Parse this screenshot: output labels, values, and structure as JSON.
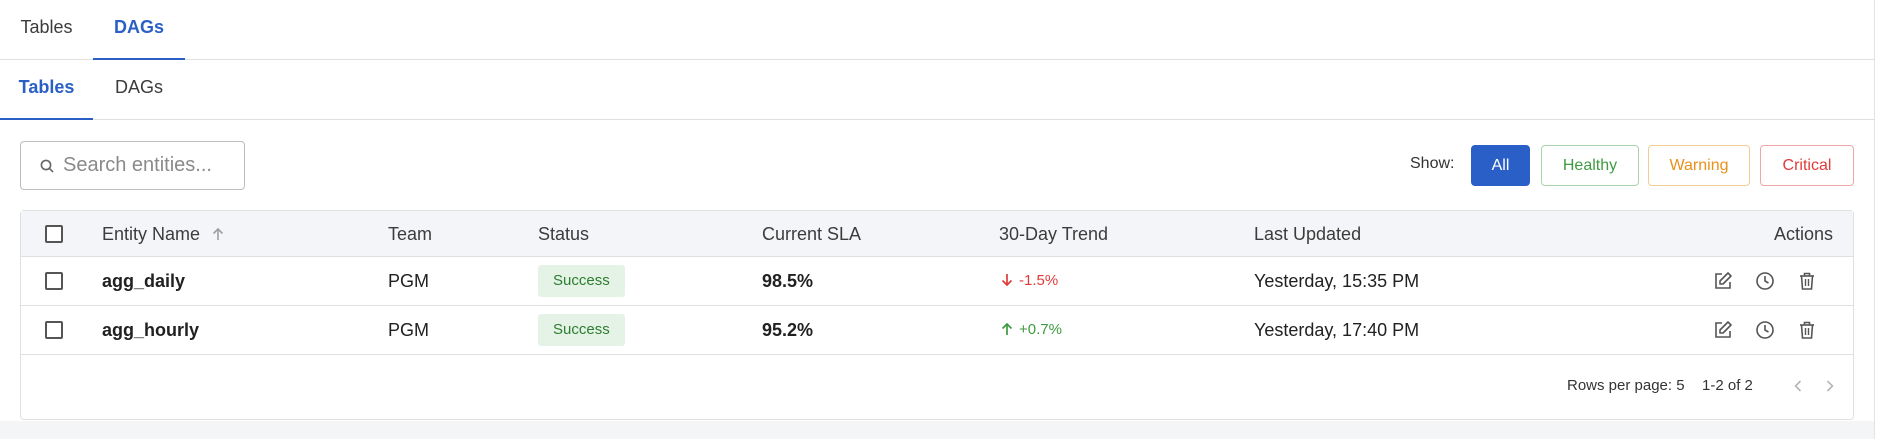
{
  "top_tabs": [
    {
      "label": "Tables",
      "active": false
    },
    {
      "label": "DAGs",
      "active": true
    }
  ],
  "sub_tabs": [
    {
      "label": "Tables",
      "active": true
    },
    {
      "label": "DAGs",
      "active": false
    }
  ],
  "search": {
    "placeholder": "Search entities...",
    "value": ""
  },
  "filters": {
    "show_label": "Show:",
    "options": [
      {
        "label": "All",
        "selected": true,
        "color": "#2a5fc7"
      },
      {
        "label": "Healthy",
        "selected": false,
        "color": "#3f9a41"
      },
      {
        "label": "Warning",
        "selected": false,
        "color": "#e8901a"
      },
      {
        "label": "Critical",
        "selected": false,
        "color": "#e03b3b"
      }
    ]
  },
  "table": {
    "columns": {
      "entity_name": "Entity Name",
      "team": "Team",
      "status": "Status",
      "current_sla": "Current SLA",
      "trend": "30-Day Trend",
      "last_updated": "Last Updated",
      "actions": "Actions"
    },
    "sort": {
      "column": "Entity Name",
      "direction": "ascending",
      "icon": "arrow-up-icon"
    },
    "rows": [
      {
        "entity_name": "agg_daily",
        "team": "PGM",
        "status": "Success",
        "current_sla": "98.5%",
        "trend": "-1.5%",
        "trend_direction": "down",
        "last_updated": "Yesterday, 15:35 PM",
        "checked": false
      },
      {
        "entity_name": "agg_hourly",
        "team": "PGM",
        "status": "Success",
        "current_sla": "95.2%",
        "trend": "+0.7%",
        "trend_direction": "up",
        "last_updated": "Yesterday, 17:40 PM",
        "checked": false
      }
    ],
    "row_actions": [
      "edit-icon",
      "history-clock-icon",
      "delete-trash-icon"
    ]
  },
  "pagination": {
    "rows_per_page": "Rows per page: 5",
    "range": "1-2 of 2",
    "prev_icon": "chevron-left-icon",
    "next_icon": "chevron-right-icon"
  },
  "colors": {
    "accent": "#2a5fc7",
    "success_badge_bg": "#e4f3e5",
    "success_text": "#2e7d32",
    "trend_down": "#e03b3b",
    "trend_up": "#3f9a41"
  }
}
